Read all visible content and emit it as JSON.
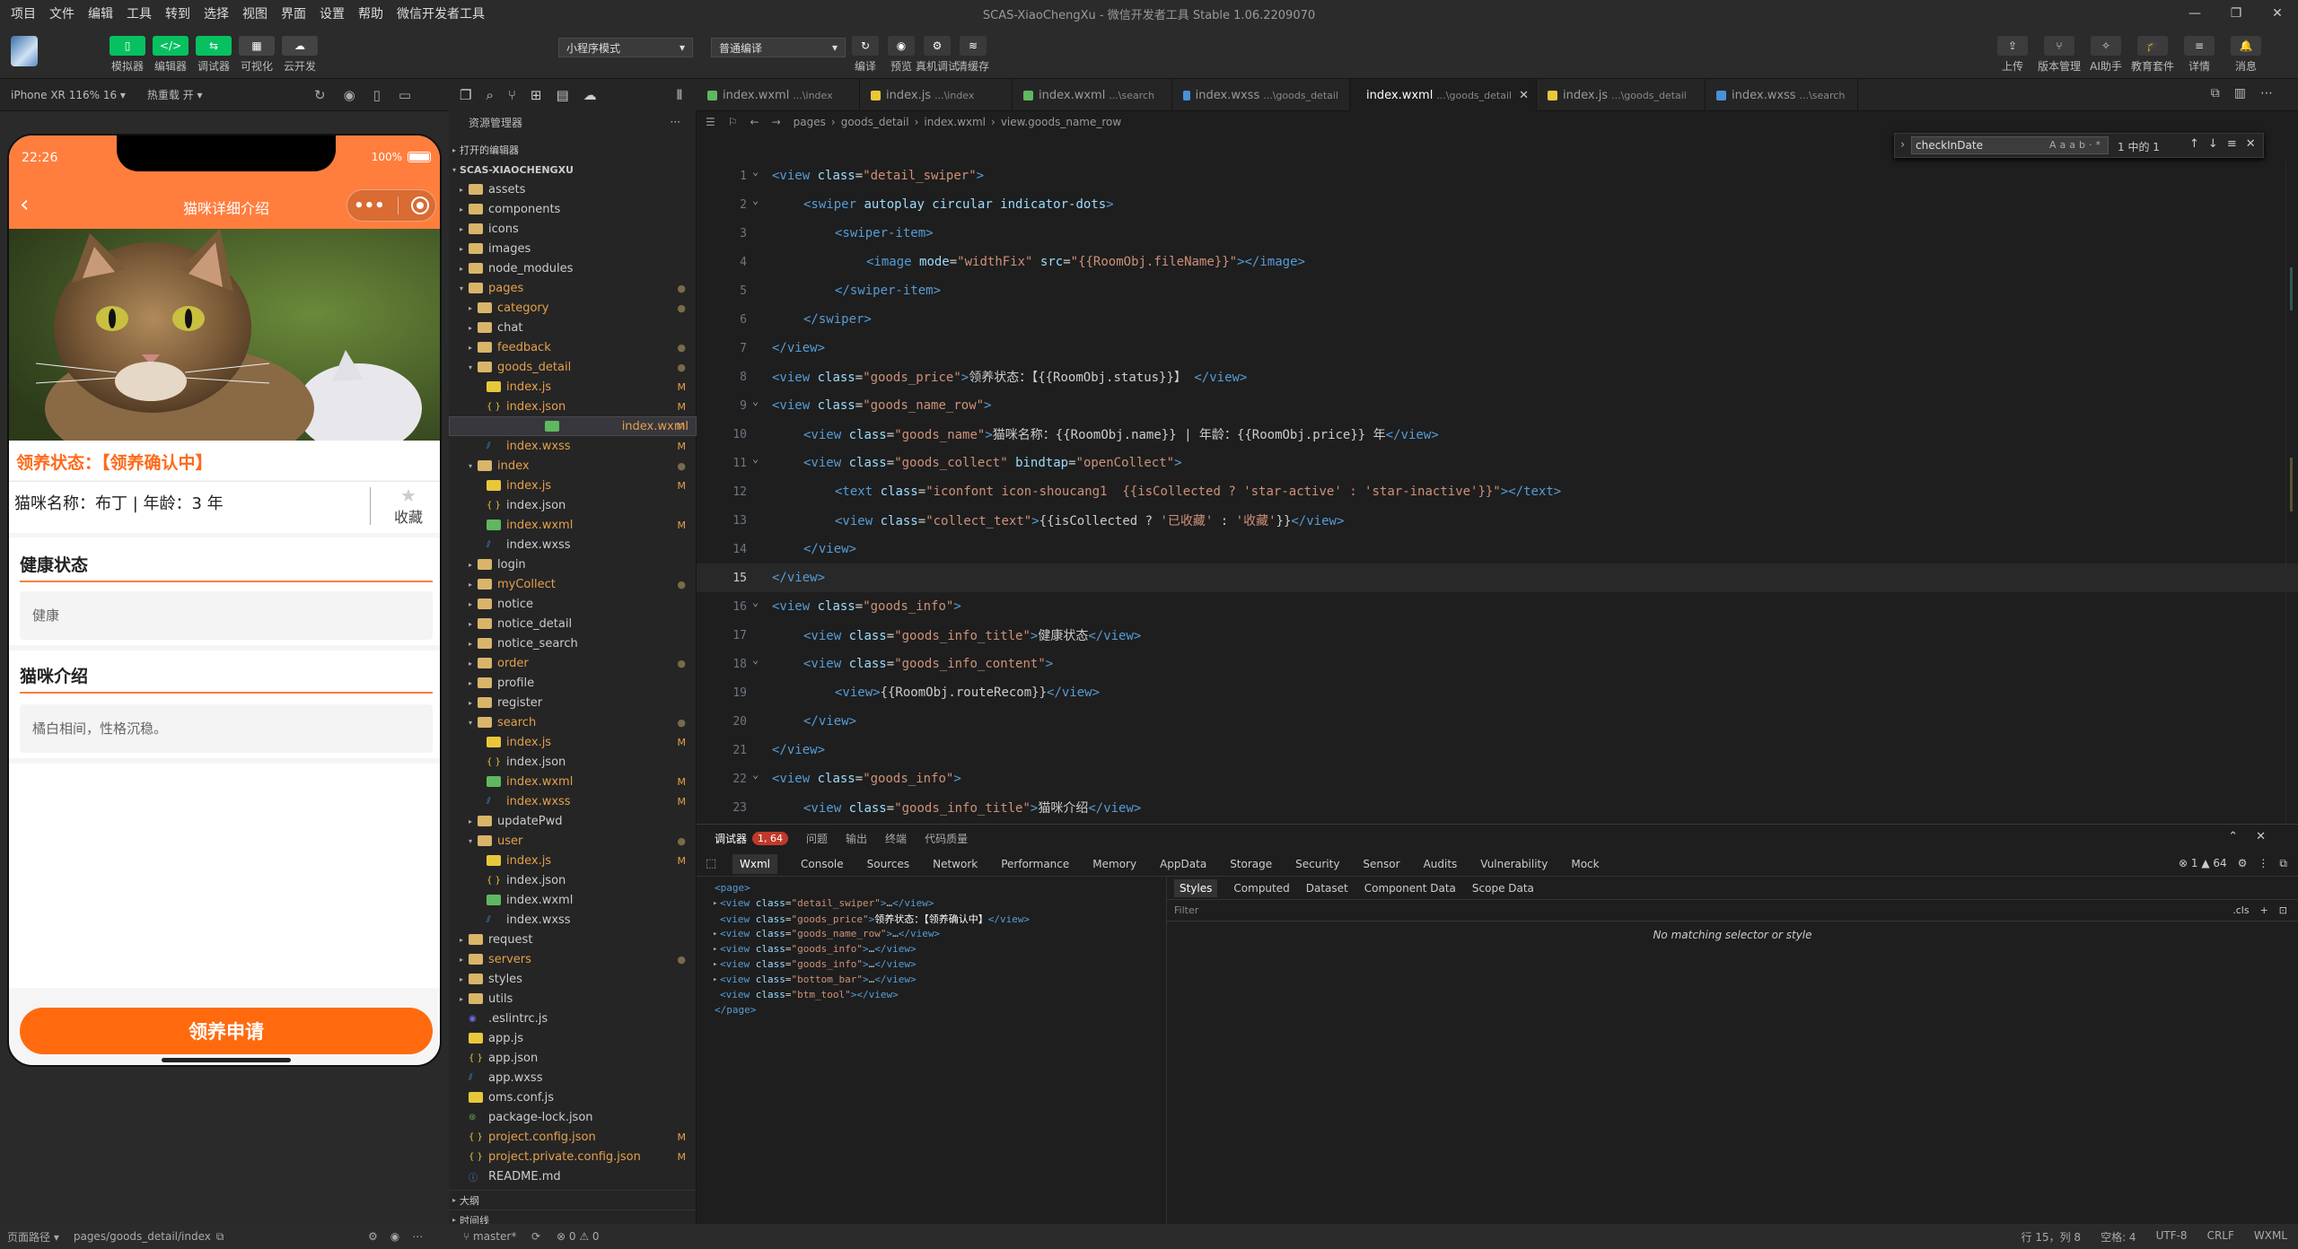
{
  "menu": [
    "项目",
    "文件",
    "编辑",
    "工具",
    "转到",
    "选择",
    "视图",
    "界面",
    "设置",
    "帮助",
    "微信开发者工具"
  ],
  "window_title": "SCAS-XiaoChengXu - 微信开发者工具 Stable 1.06.2209070",
  "window_controls": [
    "—",
    "❐",
    "✕"
  ],
  "toolbar": {
    "left_buttons": [
      {
        "label": "模拟器",
        "glyph": "▯"
      },
      {
        "label": "编辑器",
        "glyph": "</>"
      },
      {
        "label": "调试器",
        "glyph": "⇆"
      },
      {
        "label": "可视化",
        "glyph": "▦"
      },
      {
        "label": "云开发",
        "glyph": "☁"
      }
    ],
    "mode_select": "小程序模式",
    "compile_select": "普通编译",
    "mid_buttons": [
      {
        "label": "编译",
        "glyph": "↻"
      },
      {
        "label": "预览",
        "glyph": "◉"
      },
      {
        "label": "真机调试",
        "glyph": "⚙"
      },
      {
        "label": "清缓存",
        "glyph": "≋"
      }
    ],
    "right_buttons": [
      {
        "label": "上传",
        "glyph": "⇪"
      },
      {
        "label": "版本管理",
        "glyph": "⑂"
      },
      {
        "label": "AI助手",
        "glyph": "✧"
      },
      {
        "label": "教育套件",
        "glyph": "🎓"
      },
      {
        "label": "详情",
        "glyph": "≡"
      },
      {
        "label": "消息",
        "glyph": "🔔"
      }
    ]
  },
  "simulator": {
    "device": "iPhone XR 116% 16 ▾",
    "hotreload": "热重载 开 ▾",
    "time": "22:26",
    "battery": "100%",
    "nav_title": "猫咪详细介绍",
    "status_text": "领养状态：【领养确认中】",
    "name_row": "猫咪名称：布丁 | 年龄：3 年",
    "collect_label": "收藏",
    "section1_title": "健康状态",
    "section1_content": "健康",
    "section2_title": "猫咪介绍",
    "section2_content": "橘白相间，性格沉稳。",
    "apply_button": "领养申请"
  },
  "explorer": {
    "title": "资源管理器",
    "open_editors": "打开的编辑器",
    "root": "SCAS-XIAOCHENGXU",
    "outline": "大纲",
    "timeline": "时间线",
    "tree": [
      {
        "n": "assets",
        "d": 1,
        "t": "dir"
      },
      {
        "n": "components",
        "d": 1,
        "t": "dir"
      },
      {
        "n": "icons",
        "d": 1,
        "t": "dir"
      },
      {
        "n": "images",
        "d": 1,
        "t": "dir"
      },
      {
        "n": "node_modules",
        "d": 1,
        "t": "dir"
      },
      {
        "n": "pages",
        "d": 1,
        "t": "diro",
        "c": "#e5a04a",
        "s": "●"
      },
      {
        "n": "category",
        "d": 2,
        "t": "dir",
        "c": "#e5a04a",
        "s": "●"
      },
      {
        "n": "chat",
        "d": 2,
        "t": "dir"
      },
      {
        "n": "feedback",
        "d": 2,
        "t": "dir",
        "c": "#e5a04a",
        "s": "●"
      },
      {
        "n": "goods_detail",
        "d": 2,
        "t": "diro",
        "c": "#e5a04a",
        "s": "●"
      },
      {
        "n": "index.js",
        "d": 3,
        "t": "js",
        "c": "#e5a04a",
        "s": "M"
      },
      {
        "n": "index.json",
        "d": 3,
        "t": "json",
        "c": "#e5a04a",
        "s": "M"
      },
      {
        "n": "index.wxml",
        "d": 3,
        "t": "wxml",
        "c": "#e5a04a",
        "s": "M",
        "sel": true
      },
      {
        "n": "index.wxss",
        "d": 3,
        "t": "wxss",
        "c": "#e5a04a",
        "s": "M"
      },
      {
        "n": "index",
        "d": 2,
        "t": "diro",
        "c": "#e5a04a",
        "s": "●"
      },
      {
        "n": "index.js",
        "d": 3,
        "t": "js",
        "c": "#e5a04a",
        "s": "M"
      },
      {
        "n": "index.json",
        "d": 3,
        "t": "json"
      },
      {
        "n": "index.wxml",
        "d": 3,
        "t": "wxml",
        "c": "#e5a04a",
        "s": "M"
      },
      {
        "n": "index.wxss",
        "d": 3,
        "t": "wxss"
      },
      {
        "n": "login",
        "d": 2,
        "t": "dir"
      },
      {
        "n": "myCollect",
        "d": 2,
        "t": "dir",
        "c": "#e5a04a",
        "s": "●"
      },
      {
        "n": "notice",
        "d": 2,
        "t": "dir"
      },
      {
        "n": "notice_detail",
        "d": 2,
        "t": "dir"
      },
      {
        "n": "notice_search",
        "d": 2,
        "t": "dir"
      },
      {
        "n": "order",
        "d": 2,
        "t": "dir",
        "c": "#e5a04a",
        "s": "●"
      },
      {
        "n": "profile",
        "d": 2,
        "t": "dir"
      },
      {
        "n": "register",
        "d": 2,
        "t": "dir"
      },
      {
        "n": "search",
        "d": 2,
        "t": "diro",
        "c": "#e5a04a",
        "s": "●"
      },
      {
        "n": "index.js",
        "d": 3,
        "t": "js",
        "c": "#e5a04a",
        "s": "M"
      },
      {
        "n": "index.json",
        "d": 3,
        "t": "json"
      },
      {
        "n": "index.wxml",
        "d": 3,
        "t": "wxml",
        "c": "#e5a04a",
        "s": "M"
      },
      {
        "n": "index.wxss",
        "d": 3,
        "t": "wxss",
        "c": "#e5a04a",
        "s": "M"
      },
      {
        "n": "updatePwd",
        "d": 2,
        "t": "dir"
      },
      {
        "n": "user",
        "d": 2,
        "t": "diro",
        "c": "#e5a04a",
        "s": "●"
      },
      {
        "n": "index.js",
        "d": 3,
        "t": "js",
        "c": "#e5a04a",
        "s": "M"
      },
      {
        "n": "index.json",
        "d": 3,
        "t": "json"
      },
      {
        "n": "index.wxml",
        "d": 3,
        "t": "wxml"
      },
      {
        "n": "index.wxss",
        "d": 3,
        "t": "wxss"
      },
      {
        "n": "request",
        "d": 1,
        "t": "dir"
      },
      {
        "n": "servers",
        "d": 1,
        "t": "dir",
        "c": "#e5a04a",
        "s": "●"
      },
      {
        "n": "styles",
        "d": 1,
        "t": "dir"
      },
      {
        "n": "utils",
        "d": 1,
        "t": "dir"
      },
      {
        "n": ".eslintrc.js",
        "d": 1,
        "t": "eslint"
      },
      {
        "n": "app.js",
        "d": 1,
        "t": "js"
      },
      {
        "n": "app.json",
        "d": 1,
        "t": "json"
      },
      {
        "n": "app.wxss",
        "d": 1,
        "t": "wxss"
      },
      {
        "n": "oms.conf.js",
        "d": 1,
        "t": "js"
      },
      {
        "n": "package-lock.json",
        "d": 1,
        "t": "pkg"
      },
      {
        "n": "project.config.json",
        "d": 1,
        "t": "json",
        "c": "#e5a04a",
        "s": "M"
      },
      {
        "n": "project.private.config.json",
        "d": 1,
        "t": "json",
        "c": "#e5a04a",
        "s": "M"
      },
      {
        "n": "README.md",
        "d": 1,
        "t": "md"
      }
    ]
  },
  "tabs": [
    {
      "name": "index.wxml",
      "path": "...\\index",
      "t": "wxml"
    },
    {
      "name": "index.js",
      "path": "...\\index",
      "t": "js"
    },
    {
      "name": "index.wxml",
      "path": "...\\search",
      "t": "wxml"
    },
    {
      "name": "index.wxss",
      "path": "...\\goods_detail",
      "t": "wxss"
    },
    {
      "name": "index.wxml",
      "path": "...\\goods_detail",
      "t": "wxml",
      "active": true
    },
    {
      "name": "index.js",
      "path": "...\\goods_detail",
      "t": "js"
    },
    {
      "name": "index.wxss",
      "path": "...\\search",
      "t": "wxss"
    }
  ],
  "breadcrumb": [
    "pages",
    "goods_detail",
    "index.wxml",
    "view.goods_name_row"
  ],
  "find": {
    "value": "checkInDate",
    "count": "1 中的 1",
    "options": [
      "Aa",
      "ab",
      "·*"
    ]
  },
  "code_lines": [
    {
      "n": "1",
      "i": 0,
      "h": "<span class='tg'>&lt;view</span> <span class='at'>class</span>=<span class='sv'>\"detail_swiper\"</span><span class='tg'>&gt;</span>"
    },
    {
      "n": "2",
      "i": 1,
      "h": "<span class='tg'>&lt;swiper</span> <span class='at'>autoplay circular indicator-dots</span><span class='tg'>&gt;</span>"
    },
    {
      "n": "3",
      "i": 2,
      "h": "<span class='tg'>&lt;swiper-item&gt;</span>"
    },
    {
      "n": "4",
      "i": 3,
      "h": "<span class='tg'>&lt;image</span> <span class='at'>mode</span>=<span class='sv'>\"widthFix\"</span> <span class='at'>src</span>=<span class='sv'>\"{{RoomObj.fileName}}\"</span><span class='tg'>&gt;&lt;/image&gt;</span>"
    },
    {
      "n": "5",
      "i": 2,
      "h": "<span class='tg'>&lt;/swiper-item&gt;</span>"
    },
    {
      "n": "6",
      "i": 1,
      "h": "<span class='tg'>&lt;/swiper&gt;</span>"
    },
    {
      "n": "7",
      "i": 0,
      "h": "<span class='tg'>&lt;/view&gt;</span>"
    },
    {
      "n": "8",
      "i": 0,
      "h": "<span class='tg'>&lt;view</span> <span class='at'>class</span>=<span class='sv'>\"goods_price\"</span><span class='tg'>&gt;</span>领养状态：【{{RoomObj.status}}】 <span class='tg'>&lt;/view&gt;</span>"
    },
    {
      "n": "9",
      "i": 0,
      "h": "<span class='tg'>&lt;view</span> <span class='at'>class</span>=<span class='sv'>\"goods_name_row\"</span><span class='tg'>&gt;</span>"
    },
    {
      "n": "10",
      "i": 1,
      "h": "<span class='tg'>&lt;view</span> <span class='at'>class</span>=<span class='sv'>\"goods_name\"</span><span class='tg'>&gt;</span>猫咪名称：{{RoomObj.name}} | 年龄：{{RoomObj.price}} 年<span class='tg'>&lt;/view&gt;</span>"
    },
    {
      "n": "11",
      "i": 1,
      "h": "<span class='tg'>&lt;view</span> <span class='at'>class</span>=<span class='sv'>\"goods_collect\"</span> <span class='at'>bindtap</span>=<span class='sv'>\"openCollect\"</span><span class='tg'>&gt;</span>"
    },
    {
      "n": "12",
      "i": 2,
      "h": "<span class='tg'>&lt;text</span> <span class='at'>class</span>=<span class='sv'>\"iconfont icon-shoucang1  {{isCollected ? 'star-active' : 'star-inactive'}}\"</span><span class='tg'>&gt;&lt;/text&gt;</span>"
    },
    {
      "n": "13",
      "i": 2,
      "h": "<span class='tg'>&lt;view</span> <span class='at'>class</span>=<span class='sv'>\"collect_text\"</span><span class='tg'>&gt;</span>{{isCollected ? <span class='sv'>'已收藏'</span> : <span class='sv'>'收藏'</span>}}<span class='tg'>&lt;/view&gt;</span>"
    },
    {
      "n": "14",
      "i": 1,
      "h": "<span class='tg'>&lt;/view&gt;</span>"
    },
    {
      "n": "15",
      "i": 0,
      "h": "<span class='tg'>&lt;/view&gt;</span>",
      "cur": true
    },
    {
      "n": "16",
      "i": 0,
      "h": "<span class='tg'>&lt;view</span> <span class='at'>class</span>=<span class='sv'>\"goods_info\"</span><span class='tg'>&gt;</span>"
    },
    {
      "n": "17",
      "i": 1,
      "h": "<span class='tg'>&lt;view</span> <span class='at'>class</span>=<span class='sv'>\"goods_info_title\"</span><span class='tg'>&gt;</span>健康状态<span class='tg'>&lt;/view&gt;</span>"
    },
    {
      "n": "18",
      "i": 1,
      "h": "<span class='tg'>&lt;view</span> <span class='at'>class</span>=<span class='sv'>\"goods_info_content\"</span><span class='tg'>&gt;</span>"
    },
    {
      "n": "19",
      "i": 2,
      "h": "<span class='tg'>&lt;view&gt;</span>{{RoomObj.routeRecom}}<span class='tg'>&lt;/view&gt;</span>"
    },
    {
      "n": "20",
      "i": 1,
      "h": "<span class='tg'>&lt;/view&gt;</span>"
    },
    {
      "n": "21",
      "i": 0,
      "h": "<span class='tg'>&lt;/view&gt;</span>"
    },
    {
      "n": "22",
      "i": 0,
      "h": "<span class='tg'>&lt;view</span> <span class='at'>class</span>=<span class='sv'>\"goods_info\"</span><span class='tg'>&gt;</span>"
    },
    {
      "n": "23",
      "i": 1,
      "h": "<span class='tg'>&lt;view</span> <span class='at'>class</span>=<span class='sv'>\"goods_info_title\"</span><span class='tg'>&gt;</span>猫咪介绍<span class='tg'>&lt;/view&gt;</span>"
    }
  ],
  "devtools": {
    "top_tabs": [
      "调试器",
      "问题",
      "输出",
      "终端",
      "代码质量"
    ],
    "badge": "1, 64",
    "panels": [
      "Wxml",
      "Console",
      "Sources",
      "Network",
      "Performance",
      "Memory",
      "AppData",
      "Storage",
      "Security",
      "Sensor",
      "Audits",
      "Vulnerability",
      "Mock"
    ],
    "err_count": "⊗ 1 ▲ 64",
    "wxml_lines": [
      {
        "i": 0,
        "a": "",
        "h": "<span class='tg'>&lt;page&gt;</span>"
      },
      {
        "i": 1,
        "a": "▸",
        "h": "<span class='tg'>&lt;view</span> <span class='at'>class</span>=<span class='sv'>\"detail_swiper\"</span><span class='tg'>&gt;</span>…<span class='tg'>&lt;/view&gt;</span>"
      },
      {
        "i": 1,
        "a": "",
        "h": "<span class='tg'>&lt;view</span> <span class='at'>class</span>=<span class='sv'>\"goods_price\"</span><span class='tg'>&gt;</span><span class='ch'>领养状态：【领养确认中】</span><span class='tg'>&lt;/view&gt;</span>"
      },
      {
        "i": 1,
        "a": "▸",
        "h": "<span class='tg'>&lt;view</span> <span class='at'>class</span>=<span class='sv'>\"goods_name_row\"</span><span class='tg'>&gt;</span>…<span class='tg'>&lt;/view&gt;</span>"
      },
      {
        "i": 1,
        "a": "▸",
        "h": "<span class='tg'>&lt;view</span> <span class='at'>class</span>=<span class='sv'>\"goods_info\"</span><span class='tg'>&gt;</span>…<span class='tg'>&lt;/view&gt;</span>"
      },
      {
        "i": 1,
        "a": "▸",
        "h": "<span class='tg'>&lt;view</span> <span class='at'>class</span>=<span class='sv'>\"goods_info\"</span><span class='tg'>&gt;</span>…<span class='tg'>&lt;/view&gt;</span>"
      },
      {
        "i": 1,
        "a": "▸",
        "h": "<span class='tg'>&lt;view</span> <span class='at'>class</span>=<span class='sv'>\"bottom_bar\"</span><span class='tg'>&gt;</span>…<span class='tg'>&lt;/view&gt;</span>"
      },
      {
        "i": 1,
        "a": "",
        "h": "<span class='tg'>&lt;view</span> <span class='at'>class</span>=<span class='sv'>\"btm_tool\"</span><span class='tg'>&gt;&lt;/view&gt;</span>"
      },
      {
        "i": 0,
        "a": "",
        "h": "<span class='tg'>&lt;/page&gt;</span>"
      }
    ],
    "style_tabs": [
      "Styles",
      "Computed",
      "Dataset",
      "Component Data",
      "Scope Data"
    ],
    "filter_placeholder": "Filter",
    "cls": ".cls",
    "no_match": "No matching selector or style"
  },
  "status": {
    "page_path_label": "页面路径 ▾",
    "page_path": "pages/goods_detail/index",
    "branch": "master*",
    "problems": "⊗ 0 ⚠ 0",
    "cursor": "行 15，列 8",
    "spaces": "空格: 4",
    "encoding": "UTF-8",
    "eol": "CRLF",
    "lang": "WXML"
  },
  "colors": {
    "accent": "#ff7e3d",
    "brand_green": "#07c160",
    "status_title": "#ff6a1a"
  }
}
